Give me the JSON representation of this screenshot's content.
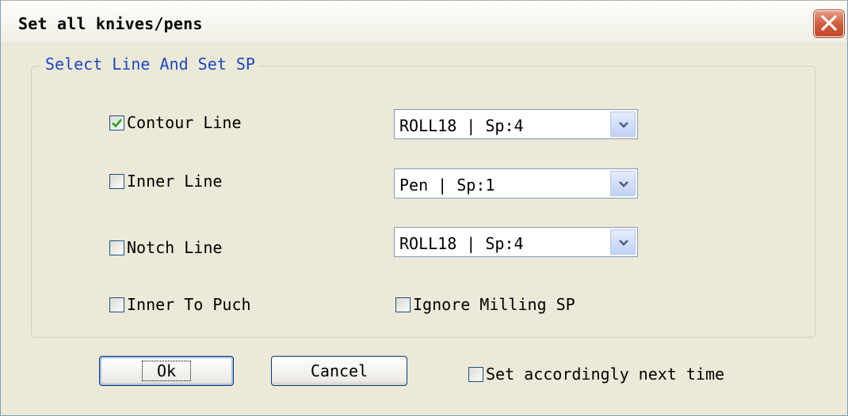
{
  "window": {
    "title": "Set all knives/pens",
    "close_icon": "close-icon"
  },
  "group": {
    "legend": "Select Line And Set SP"
  },
  "options": {
    "contour": {
      "label": "Contour Line",
      "checked": true,
      "combo_value": "ROLL18 | Sp:4"
    },
    "inner": {
      "label": "Inner Line",
      "checked": false,
      "combo_value": "Pen | Sp:1"
    },
    "notch": {
      "label": "Notch Line",
      "checked": false,
      "combo_value": "ROLL18 | Sp:4"
    },
    "inner_to_punch": {
      "label": "Inner To Puch",
      "checked": false
    },
    "ignore_milling": {
      "label": "Ignore Milling SP",
      "checked": false
    }
  },
  "buttons": {
    "ok": "Ok",
    "cancel": "Cancel"
  },
  "footer": {
    "set_next_time": {
      "label": "Set accordingly next time",
      "checked": false
    }
  },
  "colors": {
    "dialog_bg": "#ece9d8",
    "legend_text": "#1c48c0",
    "checkmark": "#21a121",
    "close_button": "#cf5b3a"
  }
}
